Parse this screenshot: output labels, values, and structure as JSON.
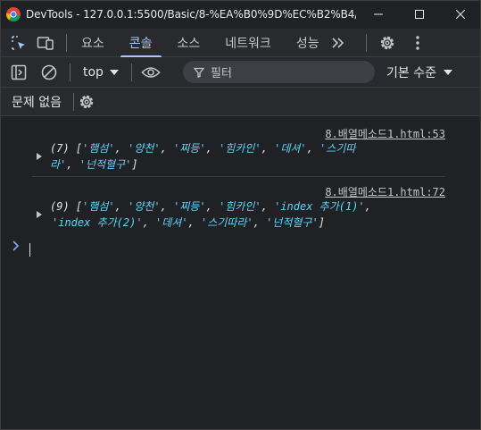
{
  "window": {
    "title": "DevTools - 127.0.0.1:5500/Basic/8-%EA%B0%9D%EC%B2%B4/8.%E..."
  },
  "tabs": [
    {
      "label": "요소"
    },
    {
      "label": "콘솔"
    },
    {
      "label": "소스"
    },
    {
      "label": "네트워크"
    },
    {
      "label": "성능"
    }
  ],
  "toolbar": {
    "context": "top",
    "filter_placeholder": "필터",
    "levels": "기본 수준"
  },
  "issues": {
    "text": "문제 없음"
  },
  "messages": [
    {
      "source": "8.배열메소드1.html:53",
      "line1": [
        "(7) [",
        "'햄섬'",
        ", ",
        "'양천'",
        ", ",
        "'찌등'",
        ", ",
        "'힘카인'",
        ", ",
        "'데셔'",
        ", ",
        "'스기따"
      ],
      "line2": [
        "라'",
        ", ",
        "'넌적혈구'",
        "]"
      ]
    },
    {
      "source": "8.배열메소드1.html:72",
      "line1": [
        "(9) [",
        "'햄섬'",
        ", ",
        "'양천'",
        ", ",
        "'찌등'",
        ", ",
        "'힘카인'",
        ", ",
        "'index 추가(1)'",
        ","
      ],
      "line2": [
        "'index 추가(2)'",
        ", ",
        "'데셔'",
        ", ",
        "'스기따라'",
        ", ",
        "'넌적혈구'",
        "]"
      ]
    }
  ],
  "colors": {
    "accent": "#a8c7fa",
    "string": "#5cd5fb",
    "background": "#202124"
  }
}
